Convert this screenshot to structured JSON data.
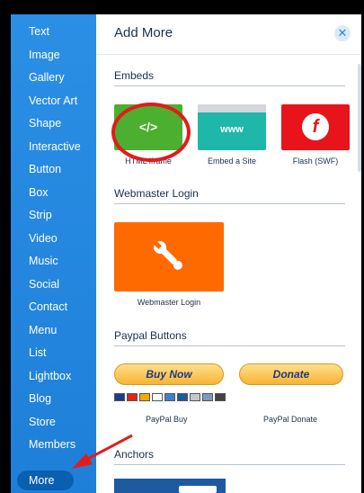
{
  "sidebar": {
    "items": [
      "Text",
      "Image",
      "Gallery",
      "Vector Art",
      "Shape",
      "Interactive",
      "Button",
      "Box",
      "Strip",
      "Video",
      "Music",
      "Social",
      "Contact",
      "Menu",
      "List",
      "Lightbox",
      "Blog",
      "Store",
      "Members"
    ],
    "active": "More"
  },
  "panel": {
    "title": "Add More",
    "close_icon": "close-icon",
    "sections": {
      "embeds": {
        "title": "Embeds",
        "items": [
          {
            "label": "HTML iframe",
            "glyph": "</>",
            "color": "#4caf2f"
          },
          {
            "label": "Embed a Site",
            "glyph": "www",
            "color": "#1fb7aa"
          },
          {
            "label": "Flash (SWF)",
            "glyph": "f",
            "color": "#e8141b"
          }
        ]
      },
      "webmaster": {
        "title": "Webmaster Login",
        "item": {
          "label": "Webmaster Login",
          "icon": "wrench-icon",
          "color": "#ff6a00"
        }
      },
      "paypal": {
        "title": "Paypal Buttons",
        "buy": {
          "button": "Buy Now",
          "label": "PayPal Buy"
        },
        "donate": {
          "button": "Donate",
          "label": "PayPal Donate"
        }
      },
      "anchors": {
        "title": "Anchors"
      }
    }
  }
}
